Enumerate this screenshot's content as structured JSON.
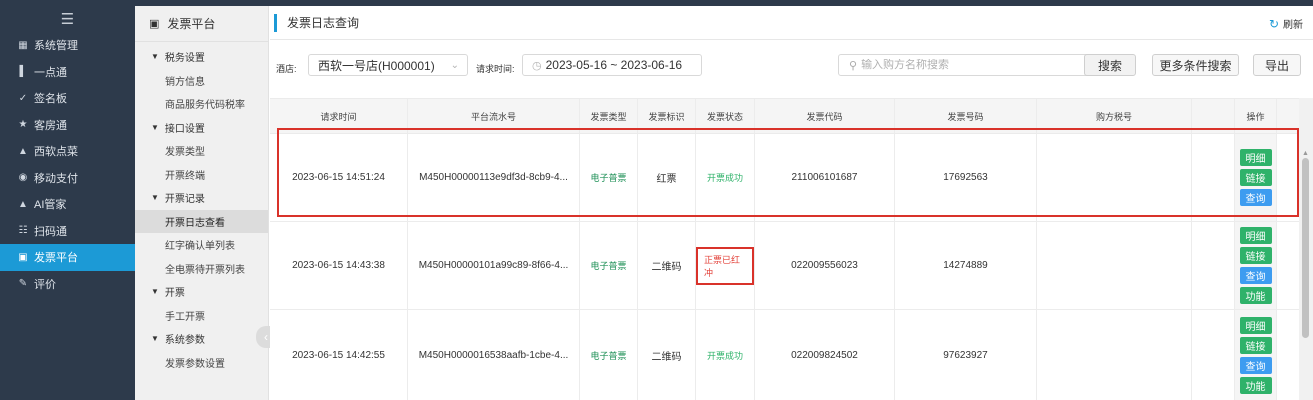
{
  "left_menu": {
    "menu_icon": "hamburger-icon",
    "items": [
      {
        "icon": "grid-icon",
        "label": "系统管理"
      },
      {
        "icon": "bar-chart-icon",
        "label": "一点通"
      },
      {
        "icon": "check-icon",
        "label": "签名板"
      },
      {
        "icon": "star-icon",
        "label": "客房通"
      },
      {
        "icon": "triangle-icon",
        "label": "西软点菜"
      },
      {
        "icon": "coin-icon",
        "label": "移动支付"
      },
      {
        "icon": "robot-icon",
        "label": "AI管家"
      },
      {
        "icon": "scan-icon",
        "label": "扫码通"
      },
      {
        "icon": "invoice-icon",
        "label": "发票平台",
        "active": true
      },
      {
        "icon": "edit-icon",
        "label": "评价"
      }
    ]
  },
  "sub_menu": {
    "header": "发票平台",
    "entries": [
      {
        "kind": "group",
        "label": "税务设置"
      },
      {
        "kind": "sub",
        "label": "销方信息"
      },
      {
        "kind": "sub",
        "label": "商品服务代码税率"
      },
      {
        "kind": "group",
        "label": "接口设置"
      },
      {
        "kind": "sub",
        "label": "发票类型"
      },
      {
        "kind": "sub",
        "label": "开票终端"
      },
      {
        "kind": "group",
        "label": "开票记录"
      },
      {
        "kind": "sub",
        "label": "开票日志查看",
        "active": true
      },
      {
        "kind": "sub",
        "label": "红字确认单列表"
      },
      {
        "kind": "sub",
        "label": "全电票待开票列表"
      },
      {
        "kind": "group",
        "label": "开票"
      },
      {
        "kind": "sub",
        "label": "手工开票"
      },
      {
        "kind": "group",
        "label": "系统参数"
      },
      {
        "kind": "sub",
        "label": "发票参数设置"
      }
    ]
  },
  "page": {
    "title": "发票日志查询",
    "refresh_label": "刷新"
  },
  "filters": {
    "hotel_label": "酒店:",
    "hotel_value": "西软一号店(H000001)",
    "time_label": "请求时间:",
    "time_value": "2023-05-16 ~ 2023-06-16",
    "search_placeholder": "输入购方名称搜索",
    "search_button": "搜索",
    "more_button": "更多条件搜索",
    "export_button": "导出"
  },
  "table": {
    "headers": [
      "请求时间",
      "平台流水号",
      "发票类型",
      "发票标识",
      "发票状态",
      "发票代码",
      "发票号码",
      "购方税号",
      "",
      "操作"
    ],
    "rows": [
      {
        "time": "2023-06-15 14:51:24",
        "serial": "M450H00000113e9df3d-8cb9-4...",
        "type": "电子普票",
        "flag": "红票",
        "status": "开票成功",
        "code": "211006101687",
        "number": "17692563",
        "buyer_tax": "",
        "extra": "",
        "ops": [
          "明细",
          "链接",
          "查询"
        ]
      },
      {
        "time": "2023-06-15 14:43:38",
        "serial": "M450H00000101a99c89-8f66-4...",
        "type": "电子普票",
        "flag": "二维码",
        "status": "正票已红冲",
        "code": "022009556023",
        "number": "14274889",
        "buyer_tax": "",
        "extra": "",
        "ops": [
          "明细",
          "链接",
          "查询",
          "功能"
        ]
      },
      {
        "time": "2023-06-15 14:42:55",
        "serial": "M450H0000016538aafb-1cbe-4...",
        "type": "电子普票",
        "flag": "二维码",
        "status": "开票成功",
        "code": "022009824502",
        "number": "97623927",
        "buyer_tax": "",
        "extra": "",
        "ops": [
          "明细",
          "链接",
          "查询",
          "功能"
        ]
      }
    ]
  },
  "colors": {
    "sidebar_bg": "#2d3a4b",
    "accent": "#1c9ad6",
    "success": "#2fb26a",
    "danger": "#d9322a",
    "op_blue": "#3d9cf0"
  }
}
